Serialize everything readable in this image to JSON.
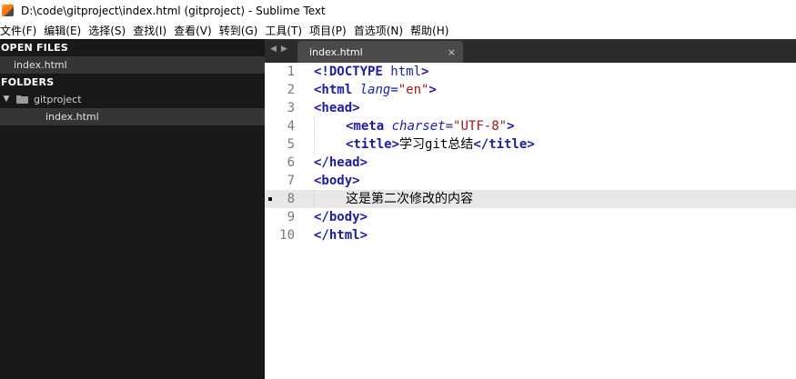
{
  "window": {
    "title": "D:\\code\\gitproject\\index.html (gitproject) - Sublime Text"
  },
  "menu": [
    {
      "label": "文件(F)"
    },
    {
      "label": "编辑(E)"
    },
    {
      "label": "选择(S)"
    },
    {
      "label": "查找(I)"
    },
    {
      "label": "查看(V)"
    },
    {
      "label": "转到(G)"
    },
    {
      "label": "工具(T)"
    },
    {
      "label": "项目(P)"
    },
    {
      "label": "首选项(N)"
    },
    {
      "label": "帮助(H)"
    }
  ],
  "sidebar": {
    "open_files_header": "OPEN FILES",
    "open_files": [
      {
        "label": "index.html"
      }
    ],
    "folders_header": "FOLDERS",
    "folder": {
      "label": "gitproject",
      "expanded": true
    },
    "folder_files": [
      {
        "label": "index.html",
        "selected": true
      }
    ]
  },
  "tabs": {
    "nav_prev": "◀",
    "nav_next": "▶",
    "items": [
      {
        "label": "index.html",
        "close": "×",
        "active": true
      }
    ]
  },
  "editor": {
    "line_numbers": [
      "1",
      "2",
      "3",
      "4",
      "5",
      "6",
      "7",
      "8",
      "9",
      "10"
    ],
    "active_line": 8,
    "lines": [
      {
        "parts": [
          [
            "t",
            "<!DOCTYPE"
          ],
          [
            "x",
            " "
          ],
          [
            "p",
            "html"
          ],
          [
            "t",
            ">"
          ]
        ]
      },
      {
        "parts": [
          [
            "t",
            "<html"
          ],
          [
            "x",
            " "
          ],
          [
            "a",
            "lang"
          ],
          [
            "p",
            "="
          ],
          [
            "s",
            "\"en\""
          ],
          [
            "t",
            ">"
          ]
        ]
      },
      {
        "parts": [
          [
            "t",
            "<head>"
          ]
        ]
      },
      {
        "indent": 1,
        "parts": [
          [
            "t",
            "<meta"
          ],
          [
            "x",
            " "
          ],
          [
            "a",
            "charset"
          ],
          [
            "p",
            "="
          ],
          [
            "s",
            "\"UTF-8\""
          ],
          [
            "t",
            ">"
          ]
        ]
      },
      {
        "indent": 1,
        "parts": [
          [
            "t",
            "<title>"
          ],
          [
            "x",
            "学习git总结"
          ],
          [
            "t",
            "</title>"
          ]
        ]
      },
      {
        "parts": [
          [
            "t",
            "</head>"
          ]
        ]
      },
      {
        "parts": [
          [
            "t",
            "<body>"
          ]
        ]
      },
      {
        "indent": 1,
        "parts": [
          [
            "x",
            "这是第二次修改的内容"
          ]
        ]
      },
      {
        "parts": [
          [
            "t",
            "</body>"
          ]
        ]
      },
      {
        "parts": [
          [
            "t",
            "</html>"
          ]
        ]
      }
    ]
  },
  "colors": {
    "tag": "#1c1ca8",
    "string": "#a31515",
    "sidebar_bg": "#181818",
    "sidebar_selected": "#353535",
    "tabbar_bg": "#2b2b2b",
    "active_line": "#e8e8e8"
  }
}
